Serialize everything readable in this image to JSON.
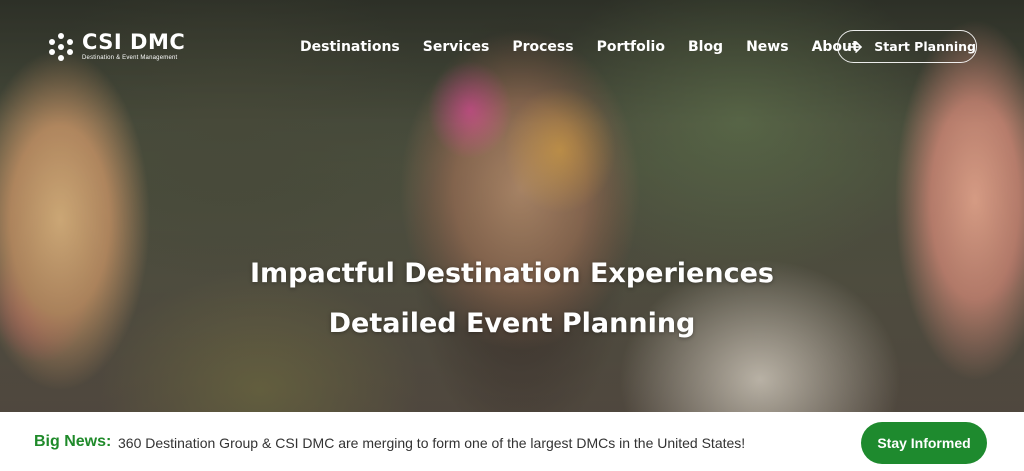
{
  "brand": {
    "name": "CSI DMC",
    "tagline": "Destination & Event Management",
    "logo_icon": "dots-cluster-icon"
  },
  "nav": {
    "items": [
      {
        "label": "Destinations"
      },
      {
        "label": "Services"
      },
      {
        "label": "Process"
      },
      {
        "label": "Portfolio"
      },
      {
        "label": "Blog"
      },
      {
        "label": "News"
      },
      {
        "label": "About"
      }
    ],
    "cta_label": "Start Planning",
    "cta_icon": "arrow-right-icon"
  },
  "hero": {
    "headline_line1": "Impactful Destination Experiences",
    "headline_line2": "Detailed Event Planning"
  },
  "news_bar": {
    "title": "Big News:",
    "text": "360 Destination Group & CSI DMC are merging to form one of the largest DMCs in the United States!",
    "button_label": "Stay Informed"
  },
  "colors": {
    "accent_green": "#1e8a2e",
    "news_title_green": "#1f8a2a",
    "nav_text": "#ffffff"
  }
}
